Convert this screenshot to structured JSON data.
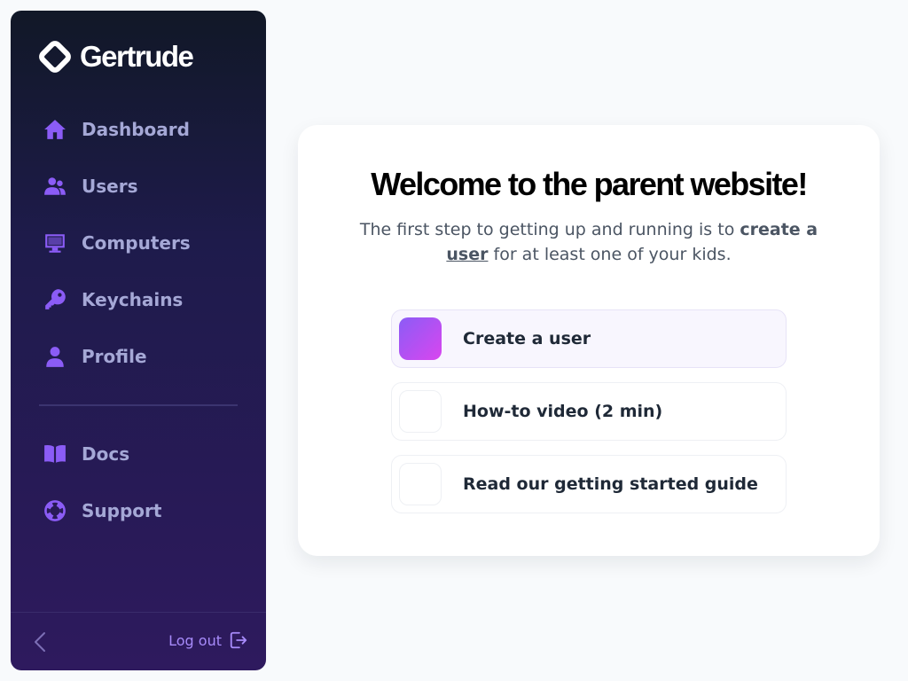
{
  "brand": {
    "name": "Gertrude"
  },
  "sidebar": {
    "nav": [
      {
        "label": "Dashboard",
        "icon": "home-icon"
      },
      {
        "label": "Users",
        "icon": "users-icon"
      },
      {
        "label": "Computers",
        "icon": "desktop-icon"
      },
      {
        "label": "Keychains",
        "icon": "key-icon"
      },
      {
        "label": "Profile",
        "icon": "user-icon"
      }
    ],
    "secondary": [
      {
        "label": "Docs",
        "icon": "book-icon"
      },
      {
        "label": "Support",
        "icon": "lifebuoy-icon"
      }
    ],
    "footer": {
      "logout_label": "Log out"
    }
  },
  "main": {
    "title": "Welcome to the parent website!",
    "subtitle_pre": "The first step to getting up and running is to",
    "subtitle_bold": "create a",
    "subtitle_link": "user",
    "subtitle_post": "for at least one of your kids.",
    "actions": [
      {
        "label": "Create a user"
      },
      {
        "label": "How-to video (2 min)"
      },
      {
        "label": "Read our getting started guide"
      }
    ]
  },
  "colors": {
    "accent": "#8b5cf6",
    "accent_gradient_end": "#d946ef",
    "sidebar_top": "#111827",
    "sidebar_bottom": "#2e1a5e",
    "nav_text": "#a5a8d6"
  }
}
